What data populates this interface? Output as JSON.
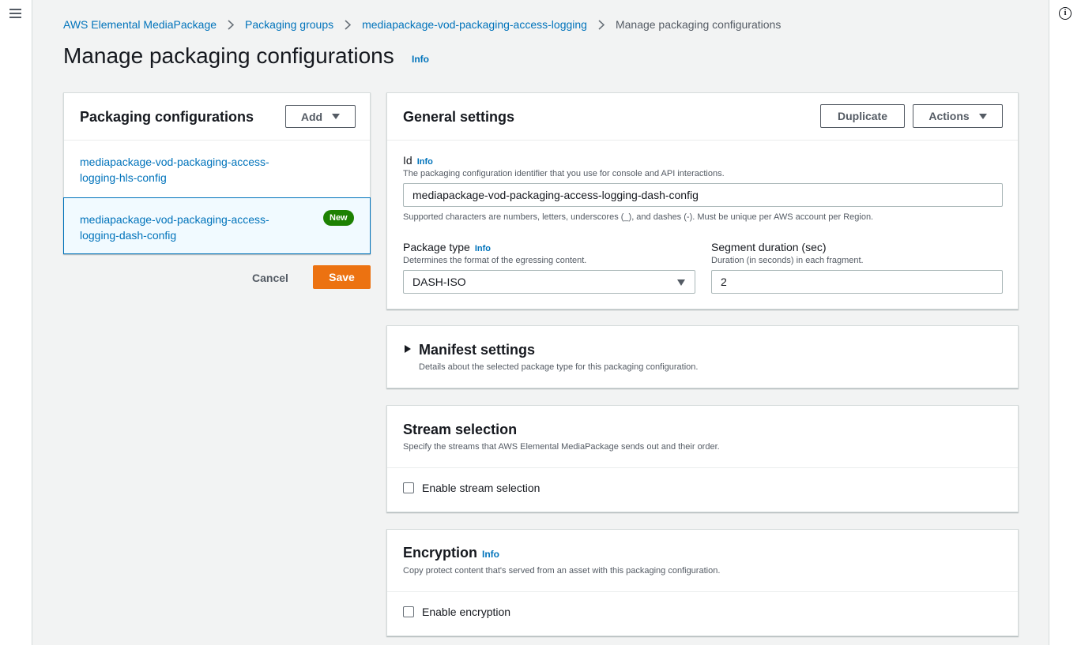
{
  "breadcrumb": {
    "items": [
      "AWS Elemental MediaPackage",
      "Packaging groups",
      "mediapackage-vod-packaging-access-logging"
    ],
    "current": "Manage packaging configurations"
  },
  "page": {
    "title": "Manage packaging configurations",
    "info": "Info"
  },
  "config_panel": {
    "title": "Packaging configurations",
    "add_label": "Add",
    "items": [
      {
        "name": "mediapackage-vod-packaging-access-logging-hls-config"
      },
      {
        "name": "mediapackage-vod-packaging-access-logging-dash-config",
        "badge": "New"
      }
    ],
    "cancel_label": "Cancel",
    "save_label": "Save"
  },
  "general": {
    "title": "General settings",
    "duplicate_label": "Duplicate",
    "actions_label": "Actions",
    "id": {
      "label": "Id",
      "info": "Info",
      "description": "The packaging configuration identifier that you use for console and API interactions.",
      "value": "mediapackage-vod-packaging-access-logging-dash-config",
      "constraint": "Supported characters are numbers, letters, underscores (_), and dashes (-). Must be unique per AWS account per Region."
    },
    "package_type": {
      "label": "Package type",
      "info": "Info",
      "description": "Determines the format of the egressing content.",
      "value": "DASH-ISO"
    },
    "segment_duration": {
      "label": "Segment duration (sec)",
      "description": "Duration (in seconds) in each fragment.",
      "value": "2"
    }
  },
  "manifest": {
    "title": "Manifest settings",
    "description": "Details about the selected package type for this packaging configuration."
  },
  "stream": {
    "title": "Stream selection",
    "description": "Specify the streams that AWS Elemental MediaPackage sends out and their order.",
    "checkbox_label": "Enable stream selection"
  },
  "encryption": {
    "title": "Encryption",
    "info": "Info",
    "description": "Copy protect content that's served from an asset with this packaging configuration.",
    "checkbox_label": "Enable encryption"
  }
}
